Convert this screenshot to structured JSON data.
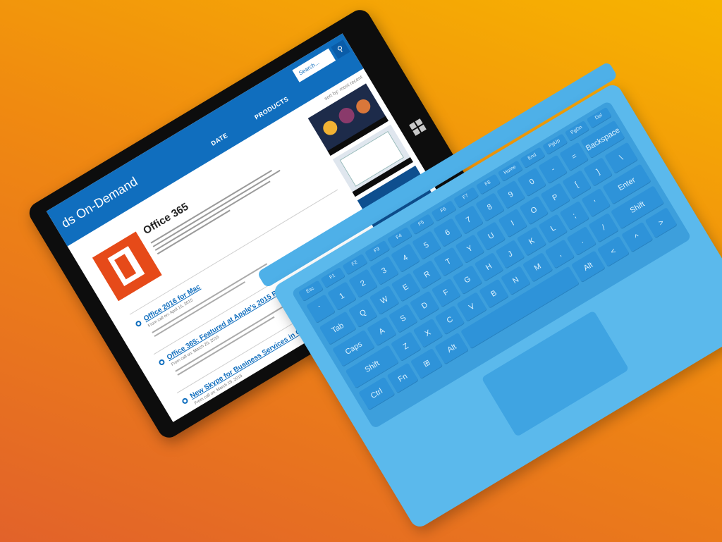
{
  "tablet": {
    "site_title": "ds On-Demand",
    "nav": {
      "date": "DATE",
      "products": "PRODUCTS"
    },
    "search": {
      "placeholder": "Search...",
      "icon": "search-icon"
    },
    "sort_label": "sort by: most recent",
    "product": {
      "title": "Office 365",
      "logo_color": "#e64a19"
    },
    "items": [
      {
        "title": "Office 2016 for Mac",
        "meta": "From call on: April 15, 2015"
      },
      {
        "title": "Office 365: Featured at Apple's 2015 Product Event",
        "meta": "From call on: March 20, 2015"
      },
      {
        "title": "New Skype for Business Services in O365",
        "meta": "From call on: March 19, 2015"
      }
    ],
    "accent_color": "#106ebe"
  },
  "keyboard": {
    "color": "#5bb9ec",
    "rows": [
      [
        "Esc",
        "F1",
        "F2",
        "F3",
        "F4",
        "F5",
        "F6",
        "F7",
        "F8",
        "Home",
        "End",
        "PgUp",
        "PgDn",
        "Del"
      ],
      [
        "`",
        "1",
        "2",
        "3",
        "4",
        "5",
        "6",
        "7",
        "8",
        "9",
        "0",
        "-",
        "=",
        "Backspace"
      ],
      [
        "Tab",
        "Q",
        "W",
        "E",
        "R",
        "T",
        "Y",
        "U",
        "I",
        "O",
        "P",
        "[",
        "]",
        "\\"
      ],
      [
        "Caps",
        "A",
        "S",
        "D",
        "F",
        "G",
        "H",
        "J",
        "K",
        "L",
        ";",
        "'",
        "Enter"
      ],
      [
        "Shift",
        "Z",
        "X",
        "C",
        "V",
        "B",
        "N",
        "M",
        ",",
        ".",
        "/",
        "Shift"
      ],
      [
        "Ctrl",
        "Fn",
        "⊞",
        "Alt",
        "",
        "Alt",
        "<",
        "^",
        ">"
      ]
    ]
  }
}
